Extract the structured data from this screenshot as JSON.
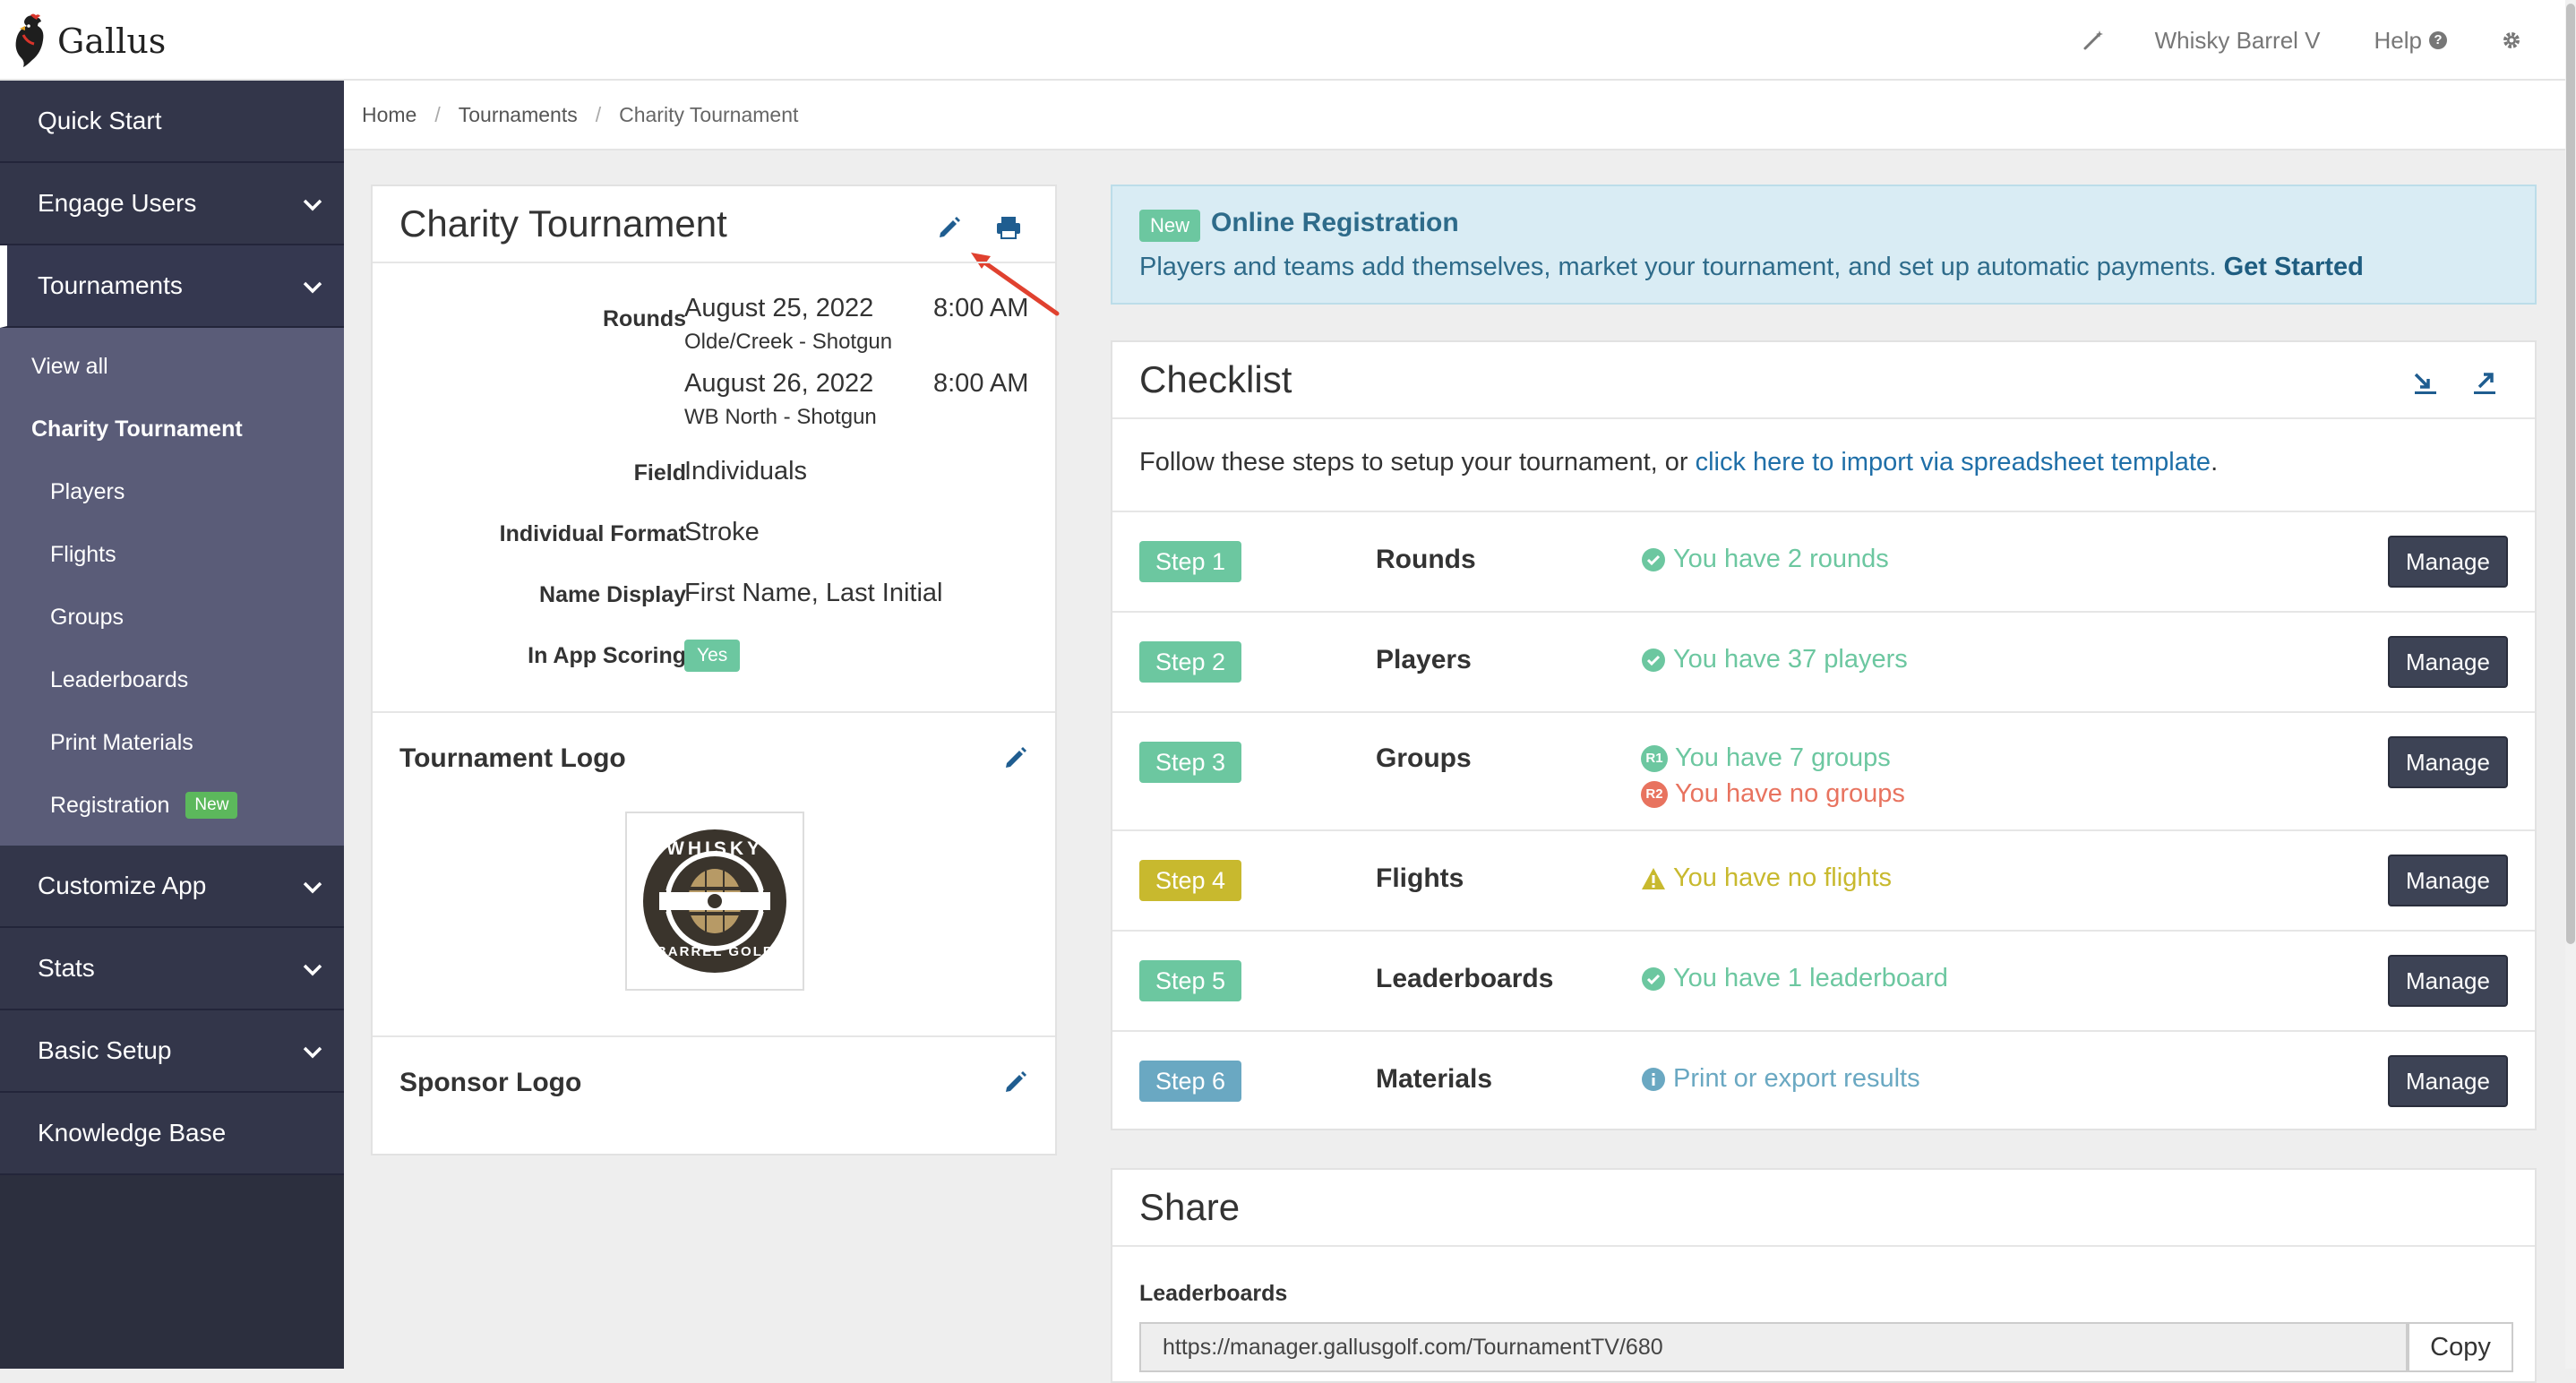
{
  "app": {
    "name": "Gallus"
  },
  "topbar": {
    "account": "Whisky Barrel V",
    "help": "Help"
  },
  "sidebar": {
    "quick_start": "Quick Start",
    "engage_users": "Engage Users",
    "tournaments": "Tournaments",
    "sub": {
      "view_all": "View all",
      "charity": "Charity Tournament",
      "players": "Players",
      "flights": "Flights",
      "groups": "Groups",
      "leaderboards": "Leaderboards",
      "print_materials": "Print Materials",
      "registration": "Registration",
      "registration_badge": "New"
    },
    "customize_app": "Customize App",
    "stats": "Stats",
    "basic_setup": "Basic Setup",
    "knowledge_base": "Knowledge Base"
  },
  "breadcrumb": [
    "Home",
    "Tournaments",
    "Charity Tournament"
  ],
  "tournament": {
    "title": "Charity Tournament",
    "rounds_label": "Rounds",
    "rounds": [
      {
        "date": "August 25, 2022",
        "time": "8:00 AM",
        "course": "Olde/Creek - Shotgun"
      },
      {
        "date": "August 26, 2022",
        "time": "8:00 AM",
        "course": "WB North - Shotgun"
      }
    ],
    "field_label": "Field",
    "field_value": "Individuals",
    "format_label": "Individual Format",
    "format_value": "Stroke",
    "name_label": "Name Display",
    "name_value": "First Name, Last Initial",
    "scoring_label": "In App Scoring",
    "scoring_value": "Yes",
    "logo_title": "Tournament Logo",
    "logo_top": "WHISKY",
    "logo_bottom": "BARREL GOLF",
    "sponsor_title": "Sponsor Logo"
  },
  "online_registration": {
    "badge": "New",
    "title": "Online Registration",
    "text": "Players and teams add themselves, market your tournament, and set up automatic payments.",
    "link": "Get Started"
  },
  "checklist": {
    "title": "Checklist",
    "intro": "Follow these steps to setup your tournament, or ",
    "intro_link": "click here to import via spreadsheet template",
    "intro_end": ".",
    "manage_label": "Manage",
    "steps": [
      {
        "badge": "Step 1",
        "name": "Rounds",
        "status": "You have 2 rounds"
      },
      {
        "badge": "Step 2",
        "name": "Players",
        "status": "You have 37 players"
      },
      {
        "badge": "Step 3",
        "name": "Groups",
        "status_r1_tag": "R1",
        "status_r1": "You have 7 groups",
        "status_r2_tag": "R2",
        "status_r2": "You have no groups"
      },
      {
        "badge": "Step 4",
        "name": "Flights",
        "status": "You have no flights"
      },
      {
        "badge": "Step 5",
        "name": "Leaderboards",
        "status": "You have 1 leaderboard"
      },
      {
        "badge": "Step 6",
        "name": "Materials",
        "status": "Print or export results"
      }
    ],
    "colors": {
      "green": "#6cc7a0",
      "yellow": "#c8b92e",
      "blue": "#6aa8c2",
      "red": "#e8735f"
    }
  },
  "share": {
    "title": "Share",
    "leaderboards_label": "Leaderboards",
    "url": "https://manager.gallusgolf.com/TournamentTV/680",
    "copy": "Copy"
  }
}
